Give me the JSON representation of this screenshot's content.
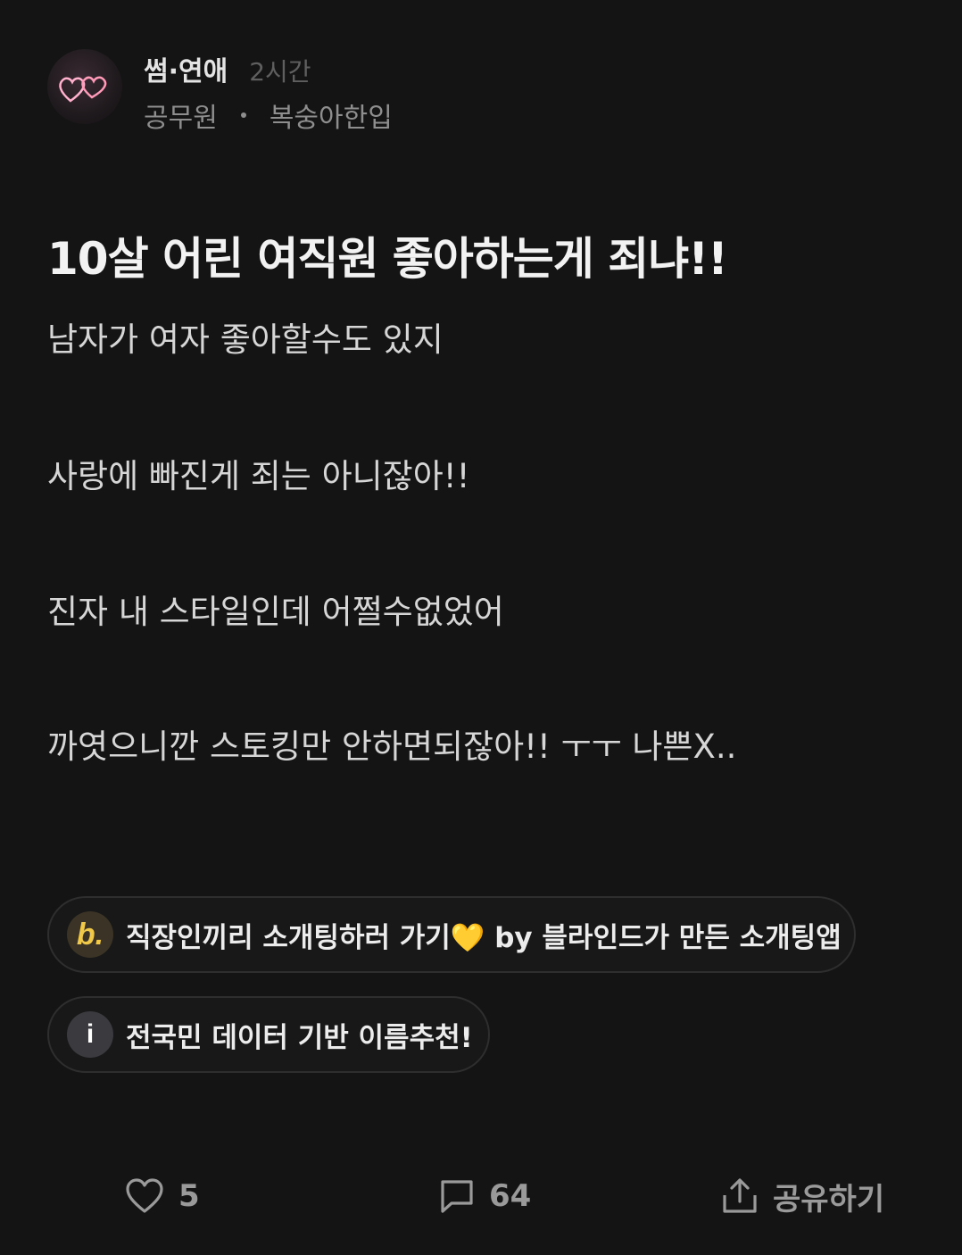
{
  "post": {
    "channel": "썸·연애",
    "time": "2시간",
    "company": "공무원",
    "nickname": "복숭아한입",
    "title": "10살 어린 여직원 좋아하는게 죄냐!!",
    "body": [
      "남자가 여자 좋아할수도 있지",
      "사랑에 빠진게 죄는 아니잖아!!",
      "진자 내 스타일인데 어쩔수없었어",
      "까엿으니깐 스토킹만 안하면되잖아!! ㅜㅜ 나쁜X.."
    ]
  },
  "promos": [
    {
      "icon_letter": "b.",
      "icon": "blind-logo-icon",
      "text": "직장인끼리 소개팅하러 가기💛 by 블라인드가 만든 소개팅앱"
    },
    {
      "icon_letter": "i",
      "icon": "info-icon",
      "text": "전국민 데이터 기반 이름추천!"
    }
  ],
  "actions": {
    "like_count": "5",
    "comment_count": "64",
    "share_label": "공유하기"
  },
  "colors": {
    "background": "#141414",
    "accent_yellow": "#f0c84a"
  }
}
